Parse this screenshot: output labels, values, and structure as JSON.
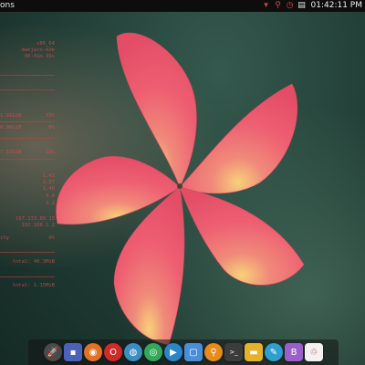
{
  "top_panel": {
    "apps_label": "ons",
    "clock": "01:42:11 PM",
    "accent": "#e24545"
  },
  "conky": {
    "system": [
      "x86_64",
      "manjaro-kde",
      "00:41m 39s"
    ],
    "ram": {
      "used": "1.91GiB",
      "percent": "33%"
    },
    "swap": {
      "used": "0.00GiB",
      "percent": "0%"
    },
    "disk": {
      "used": "7.15GiB",
      "percent": "13%"
    },
    "cpu": [
      "1.43",
      "2.27",
      "1.48"
    ],
    "cores": [
      "4.0",
      "3.2"
    ],
    "ip": {
      "public": "197.133.89.15",
      "local": "192.168.1.2"
    },
    "uptime_label": "ity",
    "uptime_value": "0%",
    "net_down": "total: 40.3MiB",
    "net_up": "total: 1.15MiB",
    "color": "#dc5050"
  },
  "dock": {
    "items": [
      {
        "name": "rocket-launcher-icon",
        "glyph": "🚀",
        "bg": "#4a4a4a"
      },
      {
        "name": "files-icon",
        "glyph": "▪",
        "bg": "#4b62b8"
      },
      {
        "name": "firefox-icon",
        "glyph": "◉",
        "bg": "#e0722a"
      },
      {
        "name": "opera-icon",
        "glyph": "O",
        "bg": "#cf2b2b"
      },
      {
        "name": "network-globe-icon",
        "glyph": "◍",
        "bg": "#3a8ec0"
      },
      {
        "name": "chromium-icon",
        "glyph": "◎",
        "bg": "#34a85a"
      },
      {
        "name": "media-player-icon",
        "glyph": "▶",
        "bg": "#2a86c7"
      },
      {
        "name": "window-icon",
        "glyph": "▢",
        "bg": "#4a8fd6"
      },
      {
        "name": "search-icon",
        "glyph": "⚲",
        "bg": "#e88a1a"
      },
      {
        "name": "terminal-icon",
        "glyph": ">_",
        "bg": "#3c3c3c"
      },
      {
        "name": "folder-icon",
        "glyph": "▬",
        "bg": "#e5b22a"
      },
      {
        "name": "notes-icon",
        "glyph": "✎",
        "bg": "#2e9ecf"
      },
      {
        "name": "vlc-icon",
        "glyph": "B",
        "bg": "#9b5fc9"
      },
      {
        "name": "trash-icon",
        "glyph": "♲",
        "bg": "#f2f2f2"
      }
    ]
  }
}
